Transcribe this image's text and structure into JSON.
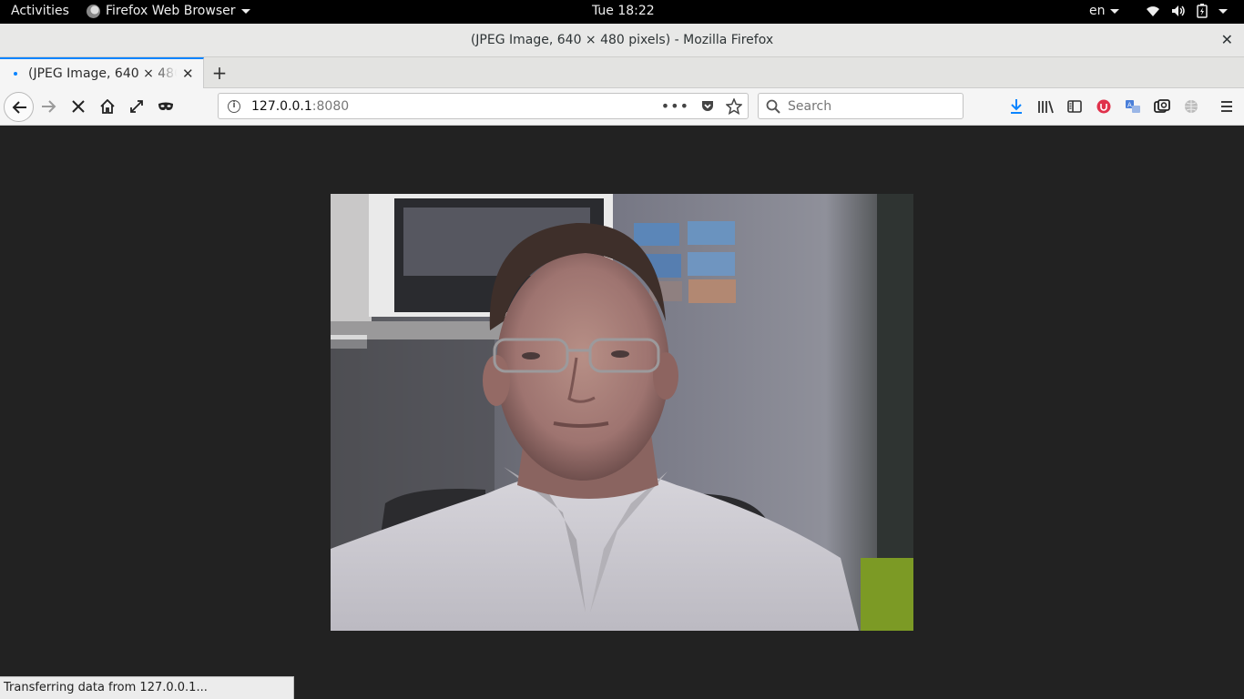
{
  "topbar": {
    "activities": "Activities",
    "app_name": "Firefox Web Browser",
    "clock": "Tue 18:22",
    "language": "en"
  },
  "window": {
    "title": "(JPEG Image, 640 × 480 pixels) - Mozilla Firefox"
  },
  "tabs": [
    {
      "label": "(JPEG Image, 640 × 480 pixels)",
      "active": true
    }
  ],
  "navbar": {
    "url_host": "127.0.0.1",
    "url_port": ":8080",
    "search_placeholder": "Search"
  },
  "content": {
    "image_description_icon": "webcam-photo"
  },
  "status": {
    "text": "Transferring data from 127.0.0.1..."
  },
  "colors": {
    "accent": "#0a84ff",
    "page_background": "#222222"
  }
}
